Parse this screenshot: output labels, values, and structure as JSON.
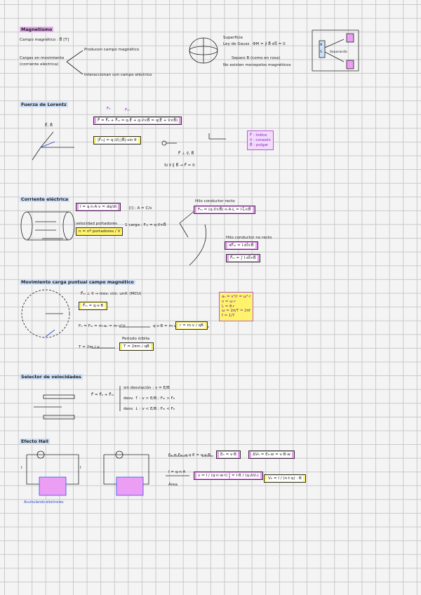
{
  "magnetismo": {
    "title": "Magnetismo",
    "campo": "Campo magnético : B⃗  [T]",
    "cargas_line1": "Cargas en movimiento",
    "cargas_line2": "(corriente eléctrica)",
    "producen": "Producen campo magnético",
    "interaccionan": "Interaccionan con campo eléctrico",
    "gauss_title": "Ley de Gauss",
    "gauss_law": "ΦM = ∮ B⃗·dS⃗ = 0",
    "superficie": "Superficie",
    "separo": "Separo B (como en rosa)",
    "no_existen": "No existen monopolos magnéticos",
    "seperando": "Separando",
    "magnet_n": "N",
    "magnet_s": "S"
  },
  "fuerza_lorentz": {
    "title": "Fuerza de Lorentz",
    "labels_top": [
      "Fₑ",
      "Fₘ"
    ],
    "formula": "F⃗ = F⃗ₑ + F⃗ₘ = q·E⃗ + q·v⃗×B⃗ = q(E⃗ + v⃗×B⃗)",
    "modulus": "|F⃗ₘ| = q·|v⃗|·|B⃗|·sin θ",
    "axis_eb": "E⃗, B⃗",
    "perp1": "F⃗ ⊥ v⃗, B⃗",
    "perp2": "Si v⃗ ∥ B⃗ → F⃗ = 0",
    "rule": [
      "F⃗ : índice",
      "v⃗ : corazón",
      "B⃗ : pulgar"
    ]
  },
  "corriente": {
    "title": "Corriente eléctrica",
    "intensity": "I = q·n·A·v = dq/dt",
    "units": "[I] : A = C/s",
    "velocidad_label": "velocidad portadores",
    "velocidad_formula": "n = nº portadores / V",
    "carga_label": "1 carga : Fₘ = q·v⃗×B⃗",
    "hilo_recto": "Hilo conductor recto",
    "hilo_recto_formula": "Fₘ = (q·v⃗×B⃗)·n·A·L = I·L⃗×B⃗",
    "hilo_curvo": "Hilo conductor no recto",
    "hilo_curvo_d": "dF⃗ₘ = I·dl⃗×B⃗",
    "hilo_curvo_int": "F⃗ₘ = ∫ I·dl⃗×B⃗"
  },
  "movimiento": {
    "title": "Movimiento carga puntual campo magnético",
    "perp": "F⃗ₘ ⊥ v⃗ → mov. circ. unif. (MCU)",
    "fm": "F⃗ₘ = q·v·B",
    "newton": "Fₙ = Fₘ = m·aₙ = m·v²/r",
    "qvb": "q·v·B = m·v²/r",
    "radius": "r = m·v / qB",
    "period": "T = 2πr / v",
    "period_label": "Periodo órbita",
    "period_formula": "T = 2πm / qB",
    "mcu": [
      "aₙ = v²/r = ω²·r",
      "v = ω·r",
      "L = θ·r",
      "ω = 2π/T = 2πf",
      "f = 1/T"
    ]
  },
  "selector": {
    "title": "Selector de velocidades",
    "equation": "F⃗ = F⃗ₑ + F⃗ₘ",
    "cases": [
      "sin desviación : v = E/B",
      "desv. ↑ : v > E/B ; Fₘ > Fₑ",
      "desv. ↓ : v < E/B ; Fₘ < Fₑ"
    ]
  },
  "hall": {
    "title": "Efecto Hall",
    "equilibrium": "Fₑ = Fₘ → q·E = q·v·B",
    "eh": "Eₕ = v·B",
    "dv": "ΔVₕ = Eₕ·w = v·B·w",
    "i_label": "I = q·n·A",
    "area": "Área",
    "v_formula": "v = I / (q·n·w·t)",
    "v_alt": "= I·B / (q·ΔVₕ)",
    "vh": "Vₕ = I / (n·t·q) · B",
    "note": "Acumulando electrones",
    "I": "I"
  },
  "colors": {
    "purple": "#b65cd6",
    "pink": "#ec9ef4",
    "yellow": "#fff36b",
    "blue": "#2244cc"
  }
}
